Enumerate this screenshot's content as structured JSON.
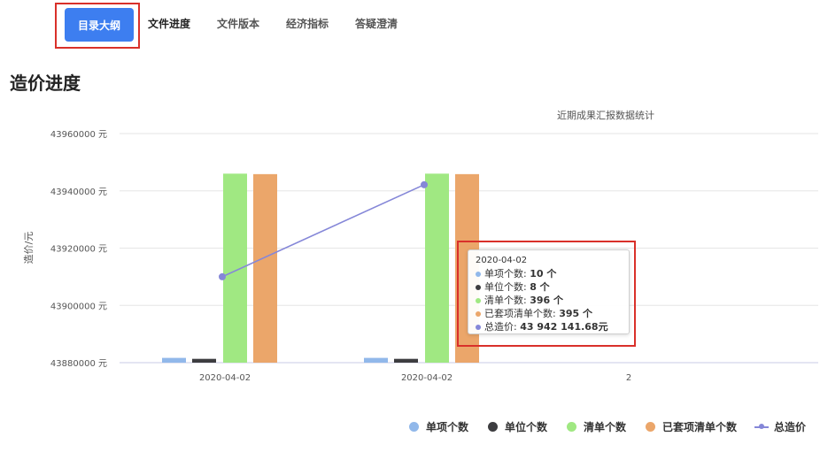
{
  "tabs": [
    {
      "label": "目录大纲",
      "active": true
    },
    {
      "label": "文件进度",
      "active": false
    },
    {
      "label": "文件版本",
      "active": false
    },
    {
      "label": "经济指标",
      "active": false
    },
    {
      "label": "答疑澄清",
      "active": false
    }
  ],
  "page_title": "造价进度",
  "chart_data": {
    "type": "bar",
    "title": "近期成果汇报数据统计",
    "ylabel": "造价/元",
    "xlabel": "",
    "categories": [
      "2020-04-02",
      "2020-04-02",
      "2"
    ],
    "ylim": [
      43880000,
      43960000
    ],
    "yticks": [
      43880000,
      43900000,
      43920000,
      43940000,
      43960000
    ],
    "yticklabels": [
      "43880000 元",
      "43900000 元",
      "43920000 元",
      "43940000 元",
      "43960000 元"
    ],
    "grid": true,
    "legend_position": "bottom-right",
    "series": [
      {
        "name": "单项个数",
        "type": "bar",
        "color": "#91b8ea",
        "values": [
          10,
          10,
          null
        ]
      },
      {
        "name": "单位个数",
        "type": "bar",
        "color": "#3d3d40",
        "values": [
          8,
          8,
          null
        ]
      },
      {
        "name": "清单个数",
        "type": "bar",
        "color": "#a0e882",
        "values": [
          396,
          396,
          null
        ]
      },
      {
        "name": "已套项清单个数",
        "type": "bar",
        "color": "#eba66a",
        "values": [
          395,
          395,
          null
        ]
      },
      {
        "name": "总造价",
        "type": "line",
        "color": "#8587d8",
        "values": [
          43910000,
          43942141.68,
          null
        ]
      }
    ]
  },
  "tooltip": {
    "date": "2020-04-02",
    "rows": [
      {
        "label": "单项个数: ",
        "value": "10 个",
        "color": "#91b8ea"
      },
      {
        "label": "单位个数: ",
        "value": "8 个",
        "color": "#3d3d40"
      },
      {
        "label": "清单个数: ",
        "value": "396 个",
        "color": "#a0e882"
      },
      {
        "label": "已套项清单个数: ",
        "value": "395 个",
        "color": "#eba66a"
      },
      {
        "label": "总造价: ",
        "value": "43 942 141.68元",
        "color": "#8587d8"
      }
    ]
  }
}
